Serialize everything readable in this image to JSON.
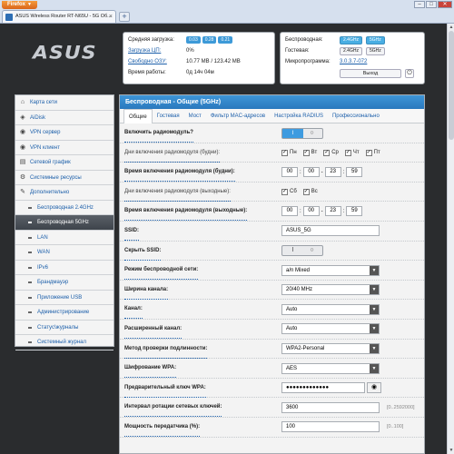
{
  "browser": {
    "app_button": "Firefox",
    "tab_title": "ASUS Wireless Router RT-N65U - 5G Об...",
    "new_tab": "+",
    "win_min": "–",
    "win_max": "□",
    "win_close": "✕"
  },
  "logo": "ASUS",
  "status": {
    "avg_load_label": "Средняя загрузка:",
    "avg_load_values": [
      "0.03",
      "0.28",
      "0.21"
    ],
    "cpu_label": "Загрузка ЦП:",
    "cpu_value": "0%",
    "ram_label": "Свободно ОЗУ:",
    "ram_value": "10.77 MB / 123.42 MB",
    "uptime_label": "Время работы:",
    "uptime_value": "0д 14ч 04м",
    "wireless_label": "Беспроводная:",
    "wireless_buttons": [
      "2.4GHz",
      "5GHz"
    ],
    "guest_label": "Гостевая:",
    "guest_buttons": [
      "2.4GHz",
      "5GHz"
    ],
    "firmware_label": "Микропрограмма:",
    "firmware_value": "3.0.3.7-072",
    "exit_label": "Выход"
  },
  "sidebar": {
    "items": [
      {
        "label": "Карта сети",
        "icon": "home-icon",
        "glyph": "⌂"
      },
      {
        "label": "AiDisk",
        "icon": "aidisk-icon",
        "glyph": "◈"
      },
      {
        "label": "VPN сервер",
        "icon": "vpn-server-icon",
        "glyph": "◉"
      },
      {
        "label": "VPN клиент",
        "icon": "vpn-client-icon",
        "glyph": "◉"
      },
      {
        "label": "Сетевой график",
        "icon": "traffic-icon",
        "glyph": "▤"
      },
      {
        "label": "Системные ресурсы",
        "icon": "resources-icon",
        "glyph": "⚙"
      },
      {
        "label": "Дополнительно",
        "icon": "wrench-icon",
        "glyph": "✎"
      }
    ],
    "subitems": [
      {
        "label": "Беспроводная 2.4GHz"
      },
      {
        "label": "Беспроводная 5GHz"
      },
      {
        "label": "LAN"
      },
      {
        "label": "WAN"
      },
      {
        "label": "IPv6"
      },
      {
        "label": "Брандмауэр"
      },
      {
        "label": "Приложение USB"
      },
      {
        "label": "Администрирование"
      },
      {
        "label": "Статус\\журналы"
      },
      {
        "label": "Системный журнал"
      }
    ]
  },
  "main": {
    "title": "Беспроводная - Общие (5GHz)",
    "tabs": [
      "Общие",
      "Гостевая",
      "Мост",
      "Фильтр MAC-адресов",
      "Настройка RADIUS",
      "Профессионально"
    ],
    "enable_radio_label": "Включить радиомодуль?",
    "toggle_on": "I",
    "toggle_off": "○",
    "weekdays_label": "Дни включения радиомодуля (будни):",
    "weekdays": [
      "Пн",
      "Вт",
      "Ср",
      "Чт",
      "Пт"
    ],
    "weekday_time_label": "Время включения радиомодуля (будни):",
    "weekday_time": [
      "00",
      "00",
      "23",
      "59"
    ],
    "weekend_label": "Дни включения радиомодуля (выходные):",
    "weekend_days": [
      "Сб",
      "Вс"
    ],
    "weekend_time_label": "Время включения радиомодуля (выходные):",
    "weekend_time": [
      "00",
      "00",
      "23",
      "59"
    ],
    "ssid_label": "SSID:",
    "ssid_value": "ASUS_5G",
    "hide_ssid_label": "Скрыть SSID:",
    "mode_label": "Режим беспроводной сети:",
    "mode_value": "a/n Mixed",
    "width_label": "Ширина канала:",
    "width_value": "20/40 MHz",
    "channel_label": "Канал:",
    "channel_value": "Auto",
    "ext_channel_label": "Расширенный канал:",
    "ext_channel_value": "Auto",
    "auth_label": "Метод проверки подлинности:",
    "auth_value": "WPA2-Personal",
    "encryption_label": "Шифрование WPA:",
    "encryption_value": "AES",
    "psk_label": "Предварительный ключ WPA:",
    "psk_value": "●●●●●●●●●●●●●",
    "rotation_label": "Интервал ротации сетевых ключей:",
    "rotation_value": "3600",
    "rotation_hint": "[0..2592000]",
    "txpower_label": "Мощность передатчика (%):",
    "txpower_value": "100",
    "txpower_hint": "[0..100]"
  }
}
